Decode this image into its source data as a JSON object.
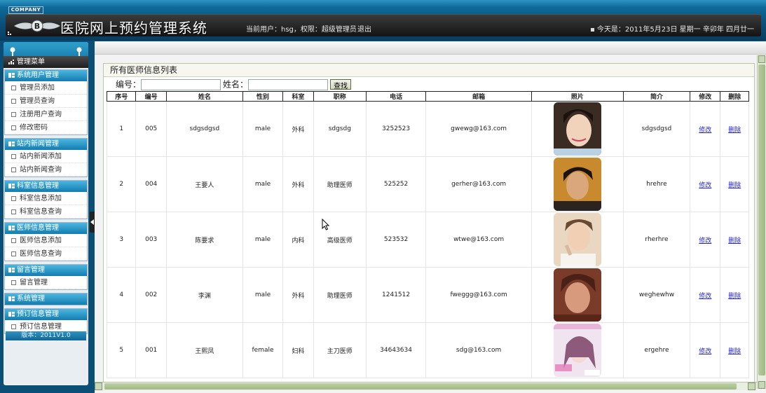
{
  "header": {
    "company_badge": "COMPANY",
    "system_title": "医院网上预约管理系统",
    "user_info": "当前用户：hsg，权限：超级管理员",
    "logout_label": "退出",
    "today": "今天是：2011年5月23日 星期一 辛卯年 四月廿一"
  },
  "sidebar": {
    "menu_title": "管理菜单",
    "groups": [
      {
        "title": "系统用户管理",
        "items": [
          "管理员添加",
          "管理员查询",
          "注册用户查询",
          "修改密码"
        ]
      },
      {
        "title": "站内新闻管理",
        "items": [
          "站内新闻添加",
          "站内新闻查询"
        ]
      },
      {
        "title": "科室信息管理",
        "items": [
          "科室信息添加",
          "科室信息查询"
        ]
      },
      {
        "title": "医师信息管理",
        "items": [
          "医师信息添加",
          "医师信息查询"
        ]
      },
      {
        "title": "留言管理",
        "items": [
          "留言管理"
        ]
      },
      {
        "title": "系统管理",
        "items": []
      },
      {
        "title": "预订信息管理",
        "items": [
          "预订信息管理"
        ]
      }
    ],
    "version": "版本：2011V1.0"
  },
  "main": {
    "list_title": "所有医师信息列表",
    "search": {
      "id_label": "编号：",
      "name_label": "姓名：",
      "button_label": "查找",
      "id_value": "",
      "name_value": ""
    },
    "table": {
      "headers": [
        "序号",
        "编号",
        "姓名",
        "性别",
        "科室",
        "职称",
        "电话",
        "邮箱",
        "照片",
        "简介",
        "修改",
        "删除"
      ],
      "rows": [
        {
          "seq": "1",
          "code": "005",
          "name": "sdgsdgsd",
          "gender": "male",
          "dept": "外科",
          "title": "sdgsdg",
          "phone": "3252523",
          "email": "gwewg@163.com",
          "bio": "sdgsdgsd",
          "edit": "修改",
          "delete": "删除"
        },
        {
          "seq": "2",
          "code": "004",
          "name": "王要人",
          "gender": "male",
          "dept": "外科",
          "title": "助理医师",
          "phone": "525252",
          "email": "gerher@163.com",
          "bio": "hrehre",
          "edit": "修改",
          "delete": "删除"
        },
        {
          "seq": "3",
          "code": "003",
          "name": "陈要求",
          "gender": "male",
          "dept": "内科",
          "title": "高级医师",
          "phone": "523532",
          "email": "wtwe@163.com",
          "bio": "rherhre",
          "edit": "修改",
          "delete": "删除"
        },
        {
          "seq": "4",
          "code": "002",
          "name": "李渊",
          "gender": "male",
          "dept": "外科",
          "title": "助理医师",
          "phone": "1241512",
          "email": "fweggg@163.com",
          "bio": "weghewhw",
          "edit": "修改",
          "delete": "删除"
        },
        {
          "seq": "5",
          "code": "001",
          "name": "王熙凤",
          "gender": "female",
          "dept": "妇科",
          "title": "主刀医师",
          "phone": "34643634",
          "email": "sdg@163.com",
          "bio": "ergehre",
          "edit": "修改",
          "delete": "删除"
        }
      ]
    }
  },
  "colors": {
    "header_dark": "#0a4f78",
    "menu_blue": "#127cb0",
    "link": "#2424c8",
    "scroll_green": "#a0b885"
  }
}
